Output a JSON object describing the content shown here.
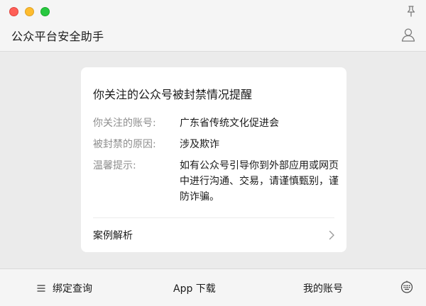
{
  "window": {
    "title": "公众平台安全助手"
  },
  "card": {
    "title": "你关注的公众号被封禁情况提醒",
    "rows": [
      {
        "label": "你关注的账号:",
        "value": "广东省传统文化促进会"
      },
      {
        "label": "被封禁的原因:",
        "value": "涉及欺诈"
      },
      {
        "label": "温馨提示:",
        "value": "如有公众号引导你到外部应用或网页中进行沟通、交易，请谨慎甄别，谨防诈骗。"
      }
    ],
    "case_link": "案例解析"
  },
  "bottom_bar": {
    "tabs": [
      {
        "label": "绑定查询",
        "icon": "menu-icon"
      },
      {
        "label": "App 下载"
      },
      {
        "label": "我的账号"
      }
    ],
    "right_icon": "keyboard-icon"
  },
  "icons": {
    "pin": "pin-icon",
    "user": "user-icon",
    "chevron": "chevron-right-icon"
  },
  "colors": {
    "background": "#ebebeb",
    "card": "#ffffff",
    "label_gray": "#8e8e8e",
    "close": "#fe5f57",
    "minimize": "#febc2e",
    "zoom": "#28c840"
  }
}
